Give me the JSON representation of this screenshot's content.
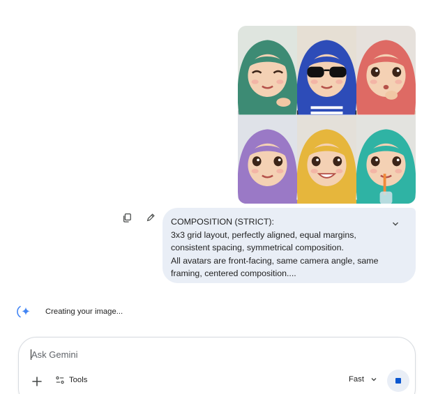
{
  "uploaded_image": {
    "cells": [
      {
        "name": "avatar-green-wink",
        "hijab": "#3d8b74",
        "bg": "#dfe5df",
        "top": "#b8bfc3"
      },
      {
        "name": "avatar-blue-sunglasses",
        "hijab": "#2d4cb8",
        "bg": "#e6dfd4",
        "top": "#2a2a2a"
      },
      {
        "name": "avatar-red-thinking",
        "hijab": "#de6a64",
        "bg": "#e6e1dc",
        "top": "#d7c5b0"
      },
      {
        "name": "avatar-purple",
        "hijab": "#9a79c6",
        "bg": "#dfe2e8",
        "top": "#9a79c6"
      },
      {
        "name": "avatar-yellow-smile",
        "hijab": "#e6b63c",
        "bg": "#e4e0d9",
        "top": "#e6b63c"
      },
      {
        "name": "avatar-teal-drink",
        "hijab": "#2fb3a4",
        "bg": "#e3e3df",
        "top": "#2fb3a4"
      }
    ]
  },
  "message": {
    "lines": [
      "COMPOSITION (STRICT):",
      "3x3 grid layout, perfectly aligned, equal margins,",
      "consistent spacing, symmetrical composition.",
      "All avatars are front-facing, same camera angle, same",
      "framing, centered composition...."
    ],
    "actions": {
      "copy_icon": "copy-icon",
      "edit_icon": "edit-icon",
      "expand_icon": "chevron-down-icon"
    }
  },
  "status": {
    "text": "Creating your image...",
    "icon": "gemini-spark-icon"
  },
  "composer": {
    "placeholder": "Ask Gemini",
    "value": "",
    "tools_label": "Tools",
    "mode_label": "Fast",
    "stop_icon": "stop-icon"
  },
  "colors": {
    "accent": "#0b57d0",
    "bubble": "#e9eef6",
    "spark_blue": "#4285f4"
  }
}
